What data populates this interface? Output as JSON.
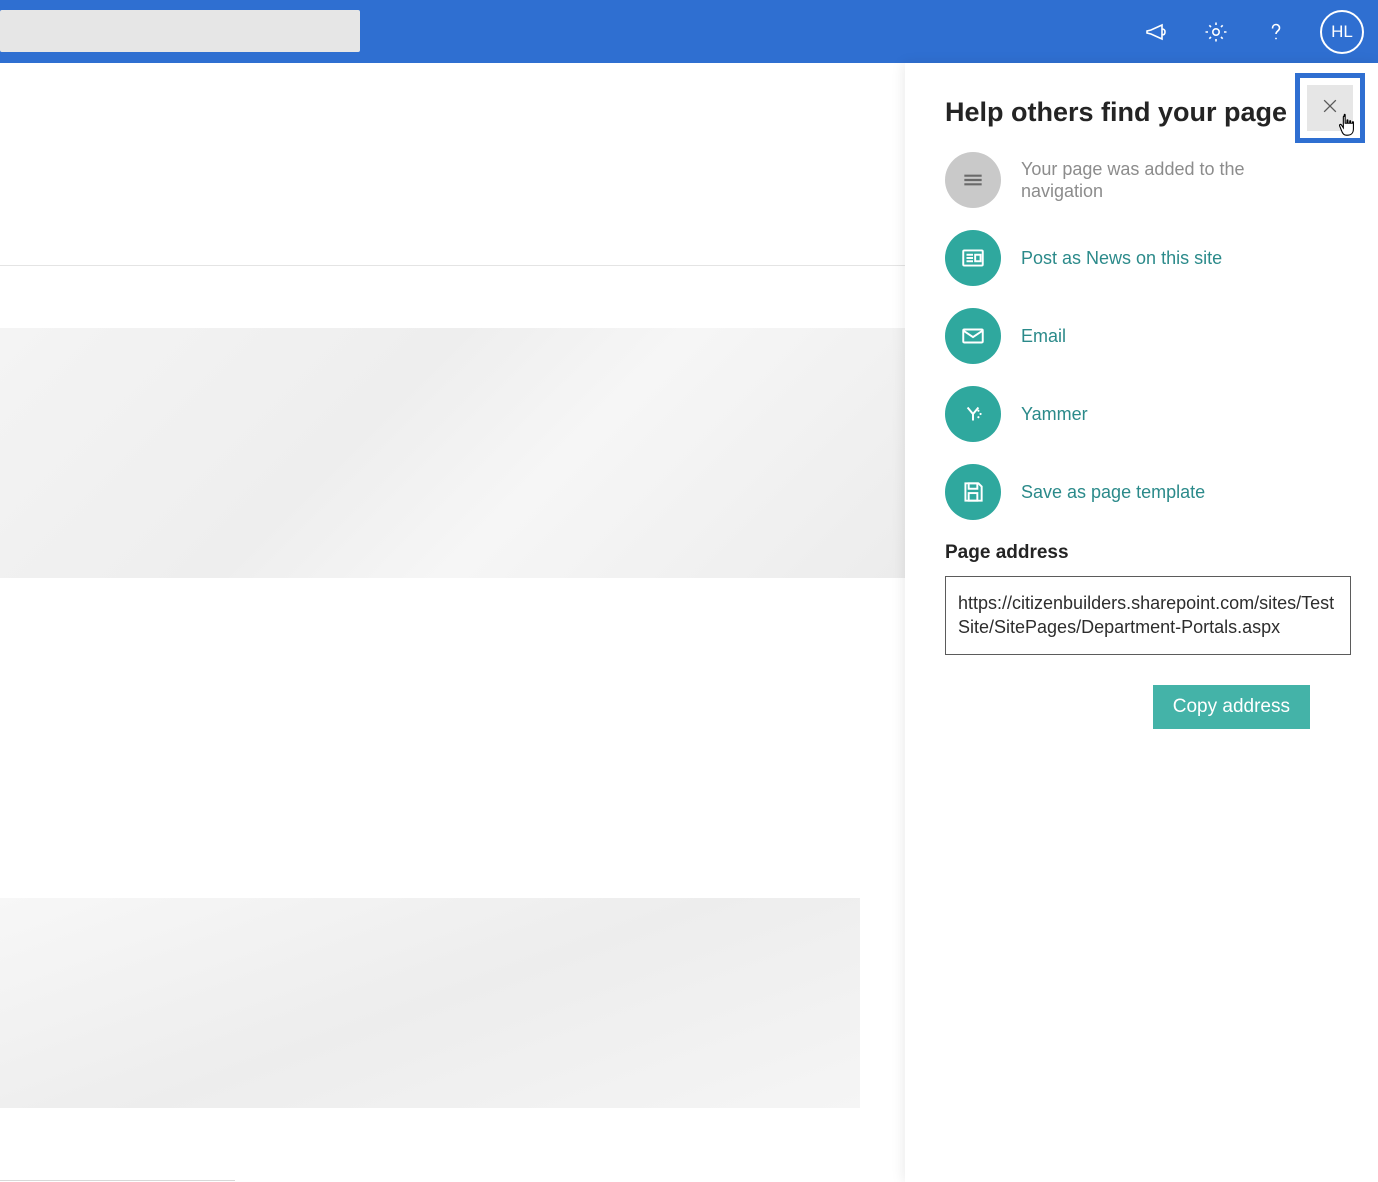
{
  "topbar": {
    "avatar_initials": "HL"
  },
  "panel": {
    "title": "Help others find your page",
    "navigation_added_text": "Your page was added to the navigation",
    "post_news_label": "Post as News on this site",
    "email_label": "Email",
    "yammer_label": "Yammer",
    "save_template_label": "Save as page template",
    "page_address_label": "Page address",
    "page_address_value": "https://citizenbuilders.sharepoint.com/sites/TestSite/SitePages/Department-Portals.aspx",
    "copy_button_label": "Copy address"
  }
}
